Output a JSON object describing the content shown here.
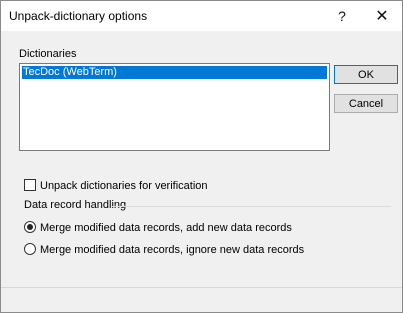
{
  "window": {
    "title": "Unpack-dictionary options",
    "help_glyph": "?",
    "close_glyph": "✕"
  },
  "dictionaries": {
    "label": "Dictionaries",
    "items": [
      "TecDoc (WebTerm)"
    ],
    "selected_index": 0
  },
  "buttons": {
    "ok": "OK",
    "cancel": "Cancel"
  },
  "verification": {
    "label": "Unpack dictionaries for verification",
    "checked": false
  },
  "data_record_handling": {
    "title": "Data record handling",
    "options": [
      "Merge modified data records, add new data records",
      "Merge modified data records, ignore new data records"
    ],
    "selected_index": 0
  }
}
